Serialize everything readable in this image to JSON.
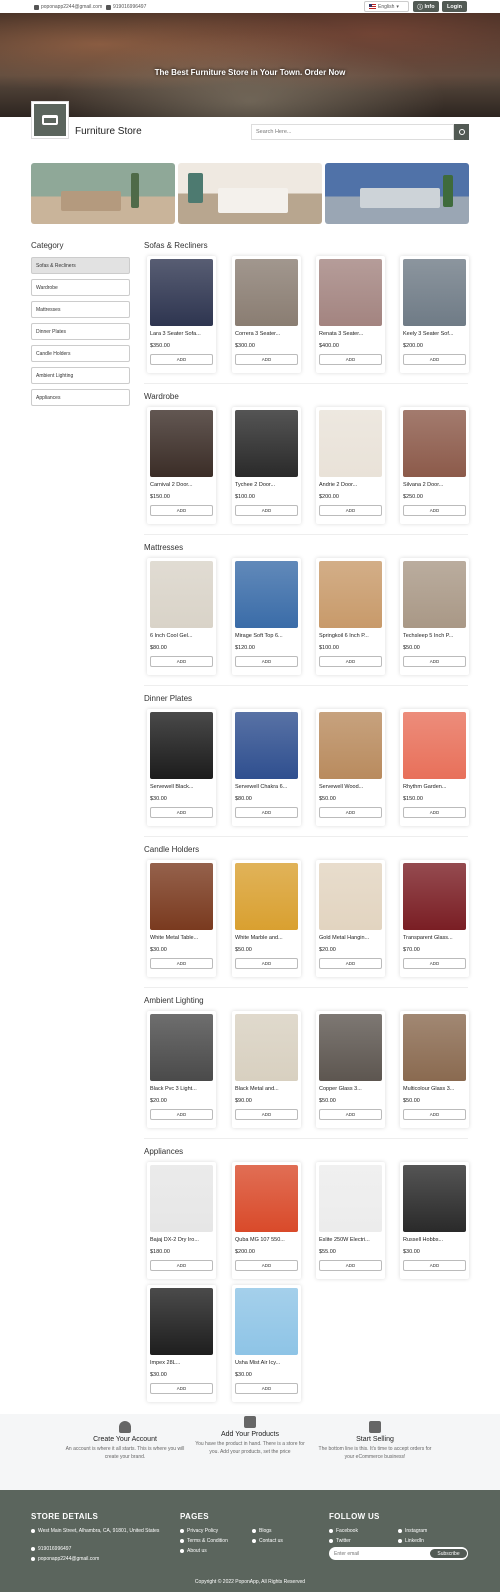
{
  "topbar": {
    "email": "poponapp2244@gmail.com",
    "phone": "919016996497",
    "language": "English",
    "info": "Info",
    "login": "Login"
  },
  "hero": {
    "title": "The Best Furniture Store in Your Town. Order Now"
  },
  "header": {
    "brand": "Furniture Store",
    "search_placeholder": "Search Here..."
  },
  "sidebar": {
    "title": "Category",
    "items": [
      "Sofas & Recliners",
      "Wardrobe",
      "Mattresses",
      "Dinner Plates",
      "Candle Holders",
      "Ambient Lighting",
      "Appliances"
    ]
  },
  "add_label": "ADD",
  "sections": [
    {
      "title": "Sofas & Recliners",
      "products": [
        {
          "name": "Lara 3 Seater Sofa...",
          "price": "$350.00",
          "color": "#2e3550"
        },
        {
          "name": "Correra 3 Seater...",
          "price": "$300.00",
          "color": "#8a7d72"
        },
        {
          "name": "Renata 3 Seater...",
          "price": "$400.00",
          "color": "#a38480"
        },
        {
          "name": "Keely 3 Seater Sof...",
          "price": "$200.00",
          "color": "#6f7b86"
        }
      ]
    },
    {
      "title": "Wardrobe",
      "products": [
        {
          "name": "Carnival 2 Door...",
          "price": "$150.00",
          "color": "#3b2d27"
        },
        {
          "name": "Tychee 2 Door...",
          "price": "$100.00",
          "color": "#2a2a2a"
        },
        {
          "name": "Andrie 2 Door...",
          "price": "$200.00",
          "color": "#e9e2d8"
        },
        {
          "name": "Silvana 2 Door...",
          "price": "$250.00",
          "color": "#8c5a4a"
        }
      ]
    },
    {
      "title": "Mattresses",
      "products": [
        {
          "name": "6 Inch Cool Gel...",
          "price": "$80.00",
          "color": "#d9d3c8"
        },
        {
          "name": "Mirage Soft Top 6...",
          "price": "$120.00",
          "color": "#3a6ca8"
        },
        {
          "name": "Springkoil 6 Inch P...",
          "price": "$100.00",
          "color": "#c89a6a"
        },
        {
          "name": "Techsleep 5 Inch P...",
          "price": "$50.00",
          "color": "#a99886"
        }
      ]
    },
    {
      "title": "Dinner Plates",
      "products": [
        {
          "name": "Servewell Black...",
          "price": "$30.00",
          "color": "#1c1c1c"
        },
        {
          "name": "Servewell Chakra 6...",
          "price": "$80.00",
          "color": "#2f4f8f"
        },
        {
          "name": "Servewell Wood...",
          "price": "$50.00",
          "color": "#b98b5e"
        },
        {
          "name": "Rhythm Garden...",
          "price": "$150.00",
          "color": "#e8705a"
        }
      ]
    },
    {
      "title": "Candle Holders",
      "products": [
        {
          "name": "White Metal Table...",
          "price": "$30.00",
          "color": "#7a3a1f"
        },
        {
          "name": "White Marble and...",
          "price": "$50.00",
          "color": "#d9a030"
        },
        {
          "name": "Gold Metal Hangin...",
          "price": "$20.00",
          "color": "#e2d4c0"
        },
        {
          "name": "Transparent Glass...",
          "price": "$70.00",
          "color": "#7a1e24"
        }
      ]
    },
    {
      "title": "Ambient Lighting",
      "products": [
        {
          "name": "Black Pvc 3 Light...",
          "price": "$20.00",
          "color": "#4a4a4a"
        },
        {
          "name": "Black Metal and...",
          "price": "$90.00",
          "color": "#d8d0c0"
        },
        {
          "name": "Copper Glass 3...",
          "price": "$50.00",
          "color": "#5d5650"
        },
        {
          "name": "Multicolour Glass 3...",
          "price": "$50.00",
          "color": "#8a6a50"
        }
      ]
    },
    {
      "title": "Appliances",
      "products": [
        {
          "name": "Bajaj DX-2 Dry Iro...",
          "price": "$180.00",
          "color": "#e6e6e6"
        },
        {
          "name": "Quba MG 107 550...",
          "price": "$200.00",
          "color": "#d94a2a"
        },
        {
          "name": "Eslite 250W Electri...",
          "price": "$55.00",
          "color": "#ececec"
        },
        {
          "name": "Russell Hobbs...",
          "price": "$30.00",
          "color": "#2a2a2a"
        },
        {
          "name": "Impex 28L...",
          "price": "$30.00",
          "color": "#1e1e1e"
        },
        {
          "name": "Usha Mist Air Icy...",
          "price": "$30.00",
          "color": "#8ec4e6"
        }
      ]
    }
  ],
  "features": [
    {
      "title": "Create Your Account",
      "text": "An account is where it all starts. This is where you will create your brand."
    },
    {
      "title": "Add Your Products",
      "text": "You have the product in hand. There is a store for you. Add your products, set the price"
    },
    {
      "title": "Start Selling",
      "text": "The bottom line is this. It's time to accept orders for your eCommerce business!"
    }
  ],
  "footer": {
    "store_title": "STORE DETAILS",
    "address": "West Main Street, Alhambra, CA, 91801, United States",
    "phone": "919016996497",
    "email": "poponapp2244@gmail.com",
    "pages_title": "PAGES",
    "pages": [
      "Privacy Policy",
      "Blogs",
      "Terms & Condition",
      "Contact us",
      "About us"
    ],
    "follow_title": "FOLLOW US",
    "social": [
      "Facebook",
      "Instagram",
      "Twitter",
      "LinkedIn"
    ],
    "email_placeholder": "Enter email",
    "subscribe": "Subscribe",
    "copyright": "Copyright © 2022 PoponApp, All Rights Reserved"
  }
}
